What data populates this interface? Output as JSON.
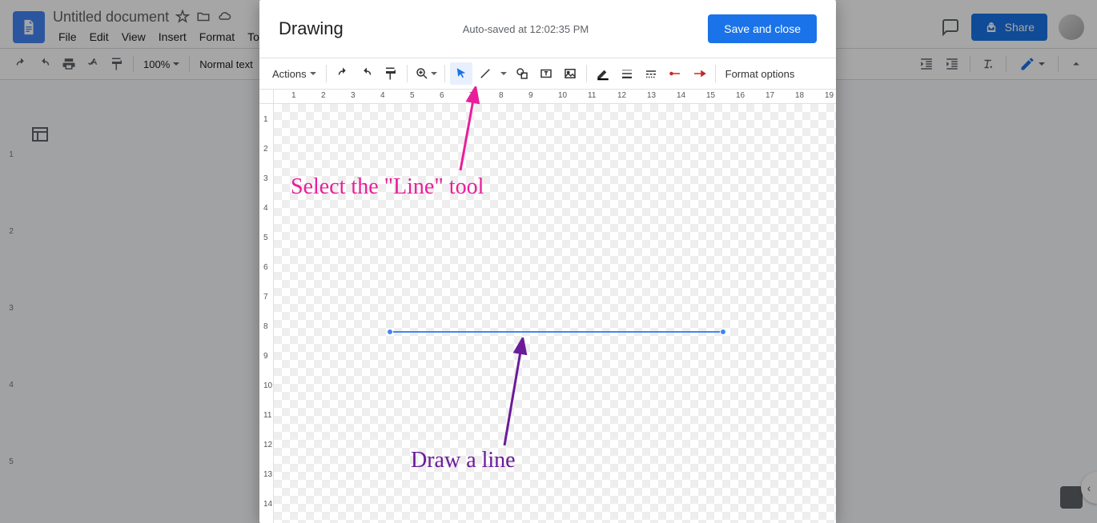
{
  "doc": {
    "title": "Untitled document",
    "menu": [
      "File",
      "Edit",
      "View",
      "Insert",
      "Format",
      "Tools"
    ],
    "share_label": "Share",
    "zoom": "100%",
    "style": "Normal text"
  },
  "drawing": {
    "title": "Drawing",
    "status": "Auto-saved at 12:02:35 PM",
    "save_close": "Save and close",
    "actions": "Actions",
    "format_options": "Format options",
    "h_ruler": [
      "1",
      "2",
      "3",
      "4",
      "5",
      "6",
      "7",
      "8",
      "9",
      "10",
      "11",
      "12",
      "13",
      "14",
      "15",
      "16",
      "17",
      "18",
      "19"
    ],
    "v_ruler": [
      "1",
      "2",
      "3",
      "4",
      "5",
      "6",
      "7",
      "8",
      "9",
      "10",
      "11",
      "12",
      "13",
      "14"
    ]
  },
  "doc_ruler_v": [
    "1",
    "2",
    "3",
    "4",
    "5"
  ],
  "annotations": {
    "a1": "Select the \"Line\" tool",
    "a2": "Draw a line"
  },
  "colors": {
    "blue": "#1a73e8",
    "pink": "#e91e9a",
    "purple": "#6a1b9a"
  }
}
